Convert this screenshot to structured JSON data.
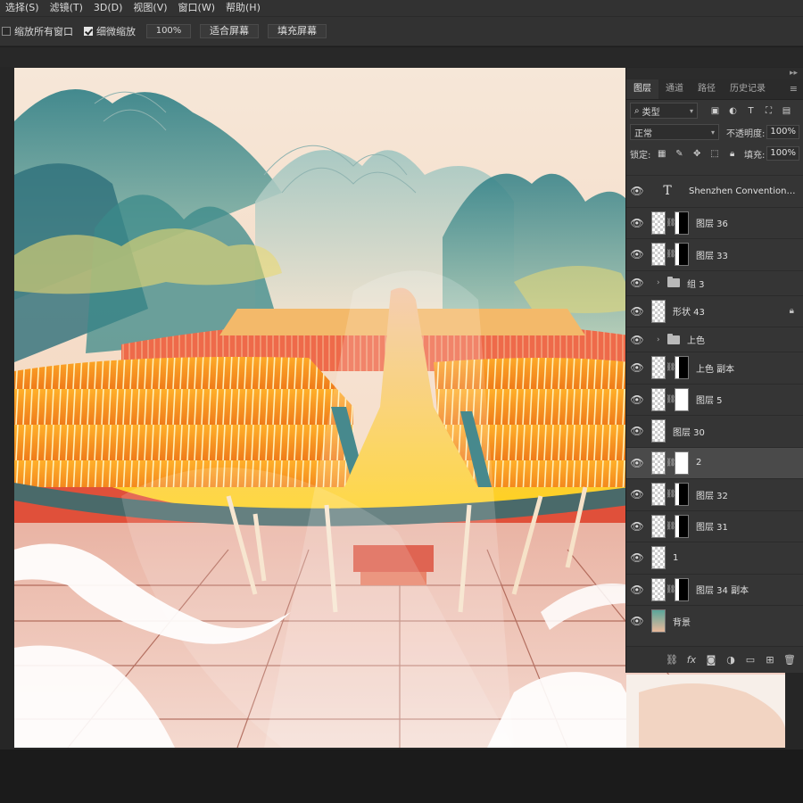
{
  "menu": [
    "选择(S)",
    "滤镜(T)",
    "3D(D)",
    "视图(V)",
    "窗口(W)",
    "帮助(H)"
  ],
  "options": {
    "resize_windows_label": "缩放所有窗口",
    "resize_windows_checked": false,
    "scrubby_zoom_label": "细微缩放",
    "scrubby_zoom_checked": true,
    "zoom_value": "100%",
    "fit_screen_label": "适合屏幕",
    "fill_screen_label": "填充屏幕"
  },
  "layers_panel": {
    "tabs": [
      "图层",
      "通道",
      "路径",
      "历史记录"
    ],
    "active_tab": "图层",
    "filter_kind": "类型",
    "blend_mode": "正常",
    "opacity_label": "不透明度:",
    "opacity_value": "100%",
    "lock_label": "锁定:",
    "fill_label": "填充:",
    "fill_value": "100%",
    "layers": [
      {
        "name": "Shenzhen Convention and...",
        "kind": "text"
      },
      {
        "name": "图层 36",
        "kind": "masked"
      },
      {
        "name": "图层 33",
        "kind": "masked"
      },
      {
        "name": "组 3",
        "kind": "group"
      },
      {
        "name": "形状 43",
        "kind": "shape",
        "locked": true
      },
      {
        "name": "上色",
        "kind": "group"
      },
      {
        "name": "上色 副本",
        "kind": "masked"
      },
      {
        "name": "图层 5",
        "kind": "masked"
      },
      {
        "name": "图层 30",
        "kind": "plain"
      },
      {
        "name": "2",
        "kind": "masked",
        "selected": true
      },
      {
        "name": "图层 32",
        "kind": "masked"
      },
      {
        "name": "图层 31",
        "kind": "masked"
      },
      {
        "name": "1",
        "kind": "plain"
      },
      {
        "name": "图层 34 副本",
        "kind": "masked"
      },
      {
        "name": "背景",
        "kind": "background"
      }
    ]
  }
}
